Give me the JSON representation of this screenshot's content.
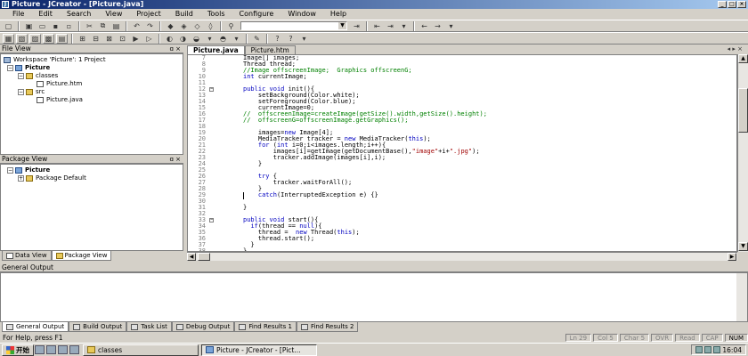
{
  "window": {
    "title": "Picture - JCreator - [Picture.java]"
  },
  "menu": [
    "File",
    "Edit",
    "Search",
    "View",
    "Project",
    "Build",
    "Tools",
    "Configure",
    "Window",
    "Help"
  ],
  "file_view": {
    "title": "File View",
    "items": [
      {
        "label": "Workspace 'Picture': 1 Project",
        "icon": "workspace-icon"
      },
      {
        "label": "Picture",
        "icon": "project-icon"
      },
      {
        "label": "classes",
        "icon": "folder-icon"
      },
      {
        "label": "Picture.htm",
        "icon": "html-file-icon"
      },
      {
        "label": "src",
        "icon": "folder-icon"
      },
      {
        "label": "Picture.java",
        "icon": "java-file-icon"
      }
    ]
  },
  "package_view": {
    "title": "Package View",
    "items": [
      {
        "label": "Picture",
        "icon": "project-icon"
      },
      {
        "label": "Package Default",
        "icon": "package-icon"
      }
    ]
  },
  "left_tabs": [
    "Data View",
    "Package View"
  ],
  "editor": {
    "tabs": [
      "Picture.java",
      "Picture.htm"
    ],
    "lines": [
      {
        "n": "7",
        "text": "Image[] images;"
      },
      {
        "n": "8",
        "text": "Thread thread;"
      },
      {
        "n": "9",
        "text": "//Image offscreenImage;  Graphics offscreenG;"
      },
      {
        "n": "10",
        "text": "int currentImage;"
      },
      {
        "n": "11",
        "text": ""
      },
      {
        "n": "12",
        "text": "public void init(){"
      },
      {
        "n": "13",
        "text": "    setBackground(Color.white);"
      },
      {
        "n": "14",
        "text": "    setForeground(Color.blue);"
      },
      {
        "n": "15",
        "text": "    currentImage=0;"
      },
      {
        "n": "16",
        "text": "//  offscreenImage=createImage(getSize().width,getSize().height);"
      },
      {
        "n": "17",
        "text": "//  offscreenG=offscreenImage.getGraphics();"
      },
      {
        "n": "18",
        "text": ""
      },
      {
        "n": "19",
        "text": "    images=new Image[4];"
      },
      {
        "n": "20",
        "text": "    MediaTracker tracker = new MediaTracker(this);"
      },
      {
        "n": "21",
        "text": "    for (int i=0;i<images.length;i++){"
      },
      {
        "n": "22",
        "text": "        images[i]=getImage(getDocumentBase(),\"image\"+i+\".jpg\");"
      },
      {
        "n": "23",
        "text": "        tracker.addImage(images[i],i);"
      },
      {
        "n": "24",
        "text": "    }"
      },
      {
        "n": "25",
        "text": ""
      },
      {
        "n": "26",
        "text": "    try {"
      },
      {
        "n": "27",
        "text": "        tracker.waitForAll();"
      },
      {
        "n": "28",
        "text": "    }"
      },
      {
        "n": "29",
        "text": "    catch(InterruptedException e) {}"
      },
      {
        "n": "30",
        "text": ""
      },
      {
        "n": "31",
        "text": "}"
      },
      {
        "n": "32",
        "text": ""
      },
      {
        "n": "33",
        "text": "public void start(){"
      },
      {
        "n": "34",
        "text": "  if(thread == null){"
      },
      {
        "n": "35",
        "text": "    thread =  new Thread(this);"
      },
      {
        "n": "36",
        "text": "    thread.start();"
      },
      {
        "n": "37",
        "text": "  }"
      },
      {
        "n": "38",
        "text": "}"
      }
    ]
  },
  "output": {
    "title": "General Output"
  },
  "bottom_tabs": [
    "General Output",
    "Build Output",
    "Task List",
    "Debug Output",
    "Find Results 1",
    "Find Results 2"
  ],
  "status": {
    "help": "For Help, press F1",
    "ln": "Ln 29",
    "col": "Col 5",
    "char": "Char 5",
    "ovr": "OVR",
    "read": "Read",
    "cap": "CAP",
    "num": "NUM"
  },
  "taskbar": {
    "start": "开始",
    "tasks": [
      "classes",
      "Picture - JCreator - [Pict..."
    ],
    "clock": "16:04"
  }
}
